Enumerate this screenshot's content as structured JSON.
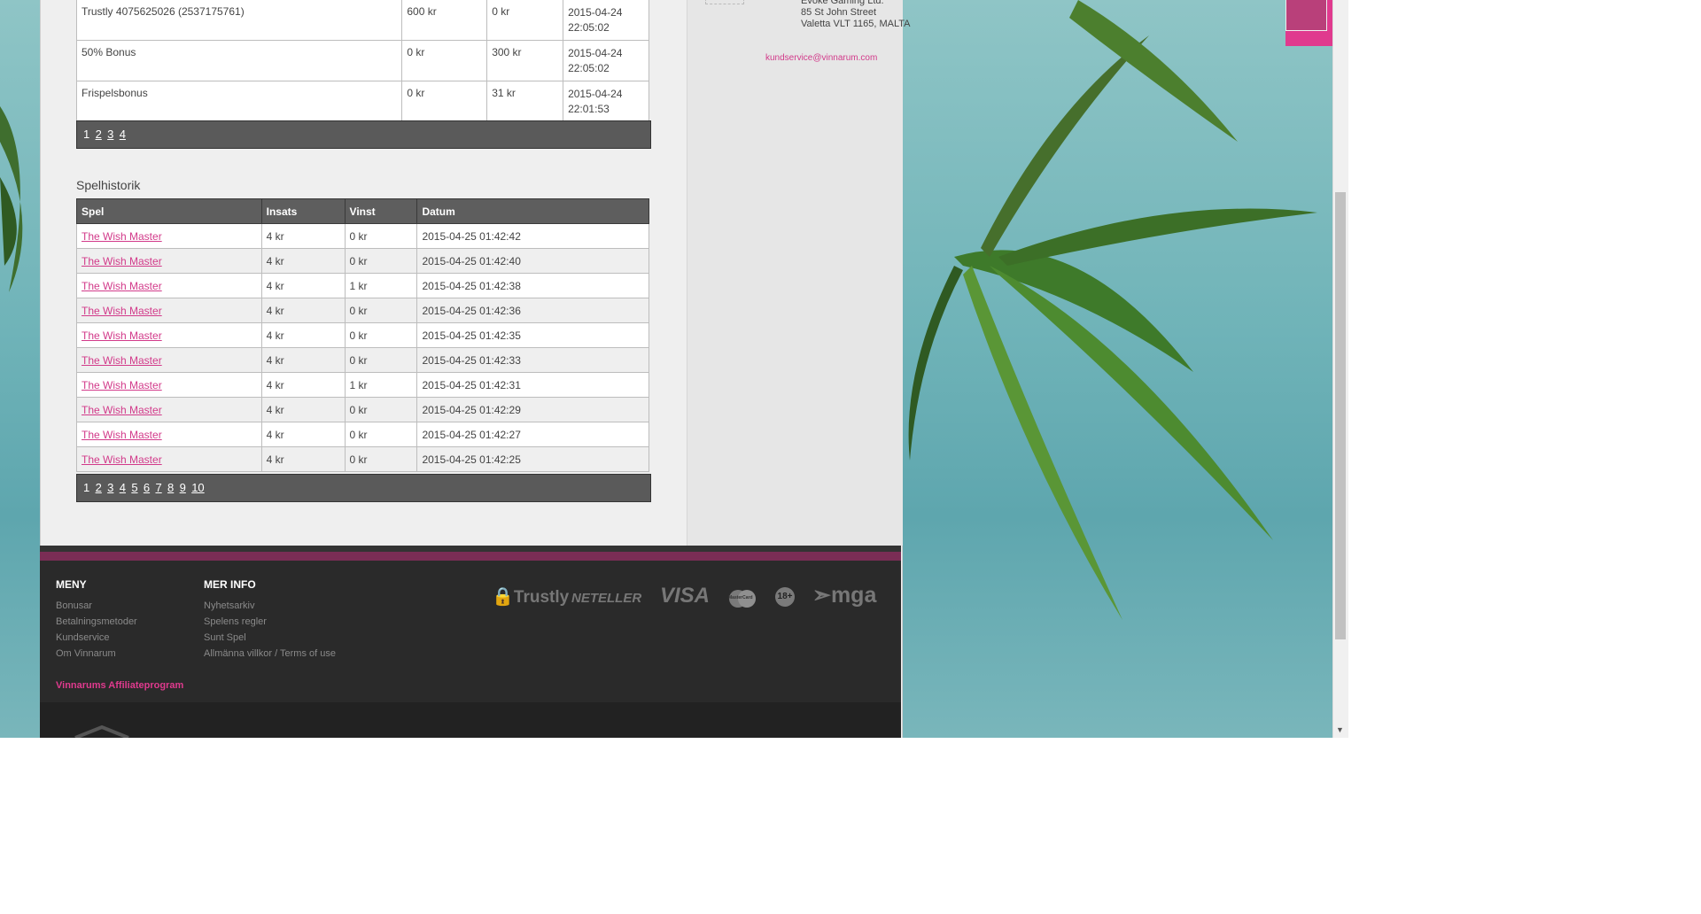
{
  "company": {
    "name": "Evoke Gaming Ltd.",
    "street": "85 St John Street",
    "city": "Valetta VLT 1165, MALTA",
    "email": "kundservice@vinnarum.com"
  },
  "transactions": {
    "rows": [
      {
        "desc": "Trustly 4075625026 (2537175761)",
        "a": "600 kr",
        "b": "0 kr",
        "date": "2015-04-24",
        "time": "22:05:02"
      },
      {
        "desc": "50% Bonus",
        "a": "0 kr",
        "b": "300 kr",
        "date": "2015-04-24",
        "time": "22:05:02"
      },
      {
        "desc": "Frispelsbonus",
        "a": "0 kr",
        "b": "31 kr",
        "date": "2015-04-24",
        "time": "22:01:53"
      }
    ],
    "pages": [
      "1",
      "2",
      "3",
      "4"
    ]
  },
  "history": {
    "title": "Spelhistorik",
    "headers": {
      "game": "Spel",
      "bet": "Insats",
      "win": "Vinst",
      "date": "Datum"
    },
    "rows": [
      {
        "game": "The Wish Master",
        "bet": "4 kr",
        "win": "0 kr",
        "date": "2015-04-25 01:42:42"
      },
      {
        "game": "The Wish Master",
        "bet": "4 kr",
        "win": "0 kr",
        "date": "2015-04-25 01:42:40"
      },
      {
        "game": "The Wish Master",
        "bet": "4 kr",
        "win": "1 kr",
        "date": "2015-04-25 01:42:38"
      },
      {
        "game": "The Wish Master",
        "bet": "4 kr",
        "win": "0 kr",
        "date": "2015-04-25 01:42:36"
      },
      {
        "game": "The Wish Master",
        "bet": "4 kr",
        "win": "0 kr",
        "date": "2015-04-25 01:42:35"
      },
      {
        "game": "The Wish Master",
        "bet": "4 kr",
        "win": "0 kr",
        "date": "2015-04-25 01:42:33"
      },
      {
        "game": "The Wish Master",
        "bet": "4 kr",
        "win": "1 kr",
        "date": "2015-04-25 01:42:31"
      },
      {
        "game": "The Wish Master",
        "bet": "4 kr",
        "win": "0 kr",
        "date": "2015-04-25 01:42:29"
      },
      {
        "game": "The Wish Master",
        "bet": "4 kr",
        "win": "0 kr",
        "date": "2015-04-25 01:42:27"
      },
      {
        "game": "The Wish Master",
        "bet": "4 kr",
        "win": "0 kr",
        "date": "2015-04-25 01:42:25"
      }
    ],
    "pages": [
      "1",
      "2",
      "3",
      "4",
      "5",
      "6",
      "7",
      "8",
      "9",
      "10"
    ]
  },
  "footer": {
    "menu_title": "MENY",
    "menu": [
      "Bonusar",
      "Betalningsmetoder",
      "Kundservice",
      "Om Vinnarum"
    ],
    "info_title": "MER INFO",
    "info": [
      "Nyhetsarkiv",
      "Spelens regler",
      "Sunt Spel",
      "Allmänna villkor / Terms of use"
    ],
    "affiliate": "Vinnarums Affiliateprogram",
    "logos": {
      "trustly": "Trustly",
      "neteller": "NETELLER",
      "visa": "VISA",
      "mastercard": "MasterCard",
      "age": "18+",
      "mga": "mga"
    }
  },
  "colors": {
    "accent": "#d23a8a",
    "footer_bg": "#2a2a2a",
    "table_header": "#5e5e5e"
  }
}
